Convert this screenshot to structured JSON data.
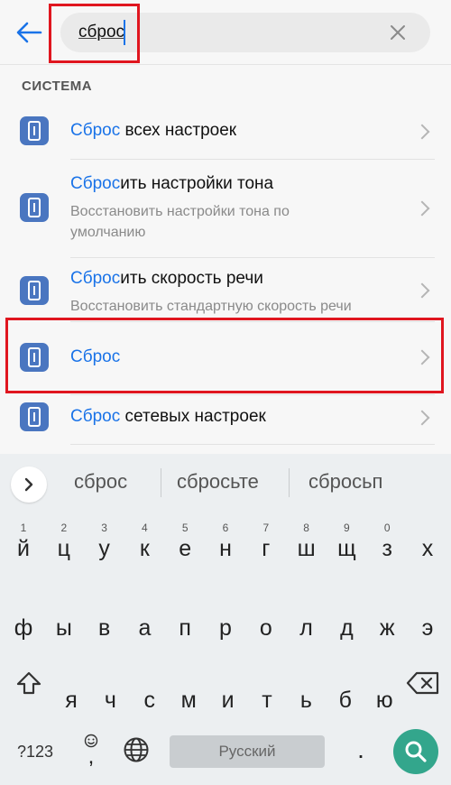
{
  "search": {
    "query": "сброс",
    "placeholder": ""
  },
  "section": {
    "title": "СИСТЕМА"
  },
  "results": [
    {
      "highlight": "Сброс",
      "rest": " всех настроек",
      "subtitle": ""
    },
    {
      "highlight": "Сброс",
      "rest": "ить настройки тона",
      "subtitle": "Восстановить настройки тона по умолчанию"
    },
    {
      "highlight": "Сброс",
      "rest": "ить скорость речи",
      "subtitle": "Восстановить стандартную скорость речи"
    },
    {
      "highlight": "Сброс",
      "rest": "",
      "subtitle": ""
    },
    {
      "highlight": "Сброс",
      "rest": " сетевых настроек",
      "subtitle": ""
    }
  ],
  "keyboard": {
    "suggestions": [
      "сброс",
      "сбросьте",
      "сбросьп"
    ],
    "row1": [
      "й",
      "ц",
      "у",
      "к",
      "е",
      "н",
      "г",
      "ш",
      "щ",
      "з",
      "х"
    ],
    "row1_numbers": [
      "1",
      "2",
      "3",
      "4",
      "5",
      "6",
      "7",
      "8",
      "9",
      "0",
      ""
    ],
    "row2": [
      "ф",
      "ы",
      "в",
      "а",
      "п",
      "р",
      "о",
      "л",
      "д",
      "ж",
      "э"
    ],
    "row3": [
      "я",
      "ч",
      "с",
      "м",
      "и",
      "т",
      "ь",
      "б",
      "ю"
    ],
    "symbols_label": "?123",
    "comma_label": ",",
    "period_label": ".",
    "space_label": "Русский"
  },
  "colors": {
    "accent": "#1a73e8",
    "highlight_box": "#e0161f",
    "icon_bg": "#4a76c0",
    "search_key": "#33a68c"
  }
}
